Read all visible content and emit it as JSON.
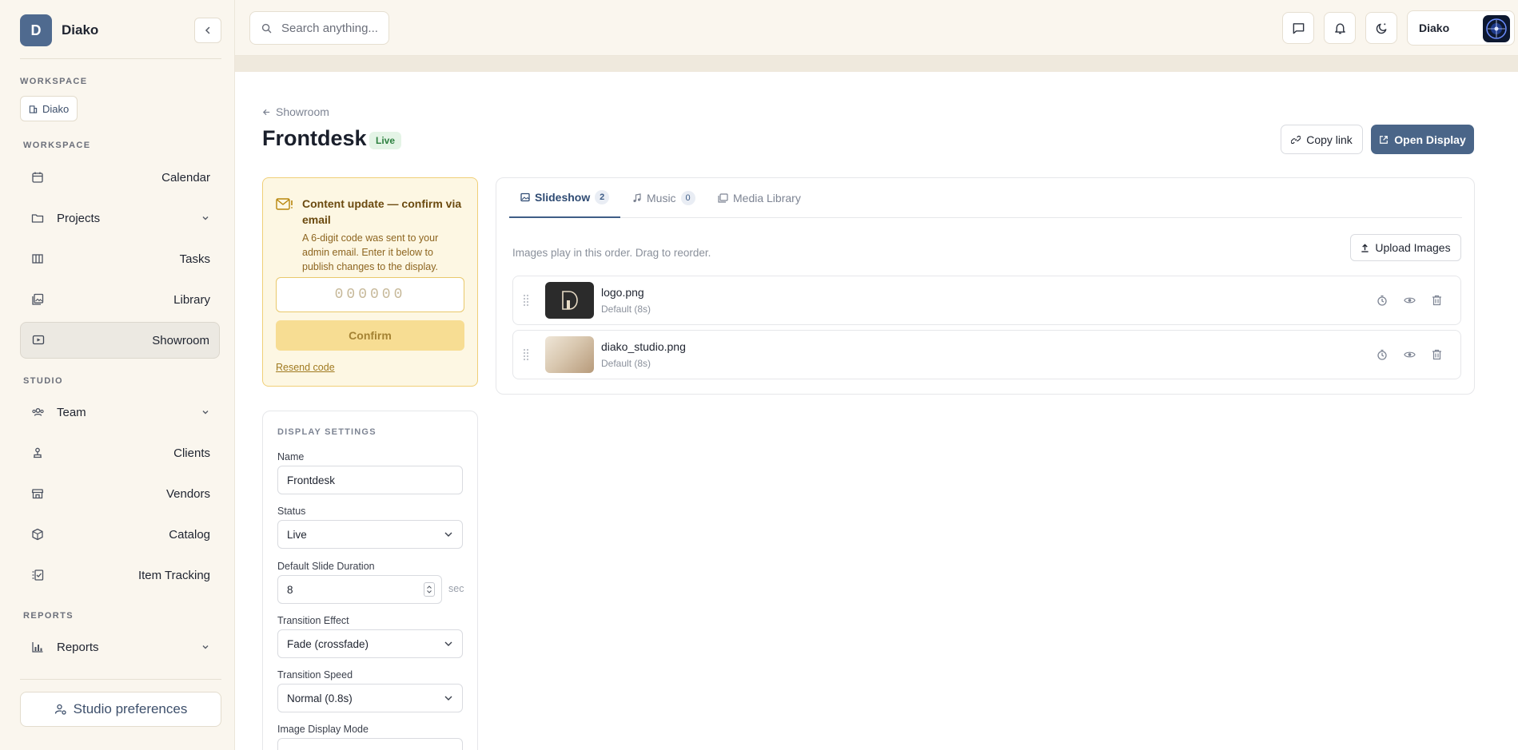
{
  "sidebar": {
    "brand_initial": "D",
    "brand_name": "Diako",
    "workspace_label": "WORKSPACE",
    "workspace_chip": "Diako",
    "workspace_nav_label": "WORKSPACE",
    "studio_label": "STUDIO",
    "reports_label": "REPORTS",
    "items": {
      "calendar": "Calendar",
      "projects": "Projects",
      "tasks": "Tasks",
      "library": "Library",
      "showroom": "Showroom",
      "team": "Team",
      "clients": "Clients",
      "vendors": "Vendors",
      "catalog": "Catalog",
      "item_tracking": "Item Tracking",
      "reports": "Reports"
    },
    "preferences": "Studio preferences"
  },
  "topbar": {
    "search_placeholder": "Search anything...",
    "user_name": "Diako"
  },
  "page": {
    "back_label": "Showroom",
    "title": "Frontdesk",
    "status_badge": "Live",
    "copy_link": "Copy link",
    "open_display": "Open Display"
  },
  "confirm": {
    "title": "Content update — confirm via email",
    "description": "A 6-digit code was sent to your admin email. Enter it below to publish changes to the display.",
    "code_placeholder": "000000",
    "confirm_label": "Confirm",
    "resend_label": "Resend code"
  },
  "settings": {
    "heading": "DISPLAY SETTINGS",
    "name_label": "Name",
    "name_value": "Frontdesk",
    "status_label": "Status",
    "status_value": "Live",
    "duration_label": "Default Slide Duration",
    "duration_value": "8",
    "duration_unit": "sec",
    "transition_label": "Transition Effect",
    "transition_value": "Fade (crossfade)",
    "speed_label": "Transition Speed",
    "speed_value": "Normal (0.8s)",
    "mode_label": "Image Display Mode"
  },
  "slideshow": {
    "tabs": [
      {
        "label": "Slideshow",
        "count": "2"
      },
      {
        "label": "Music",
        "count": "0"
      },
      {
        "label": "Media Library"
      }
    ],
    "helper": "Images play in this order. Drag to reorder.",
    "upload_label": "Upload Images",
    "images": [
      {
        "name": "logo.png",
        "duration": "Default (8s)"
      },
      {
        "name": "diako_studio.png",
        "duration": "Default (8s)"
      }
    ]
  },
  "colors": {
    "accent": "#4a6588",
    "live_badge": "#2d8040",
    "warning_border": "#f0cf78"
  }
}
